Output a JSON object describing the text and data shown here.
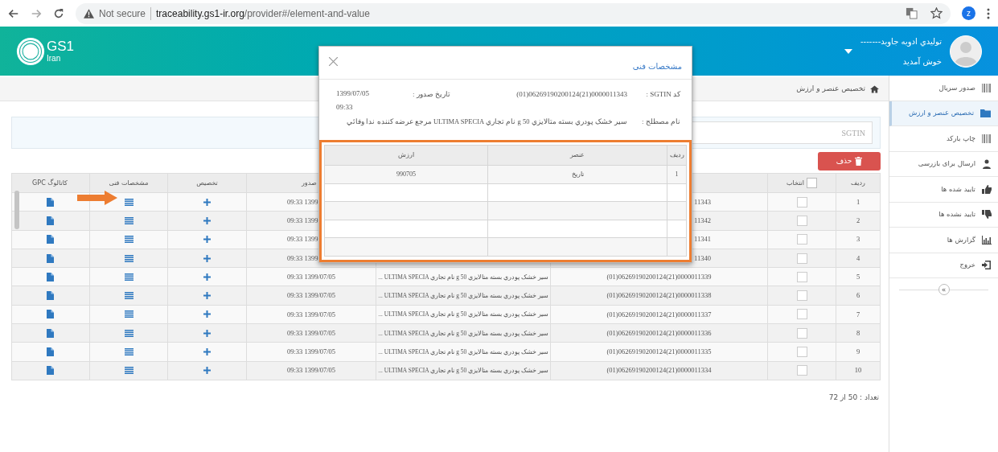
{
  "browser": {
    "security": "Not secure",
    "url_host": "traceability.gs1-ir.org",
    "url_path": "/provider#/element-and-value",
    "profile_initial": "z"
  },
  "header": {
    "logo_text": "GS1",
    "logo_sub": "Iran",
    "user_name": "-------تولیدي ادویه جاوید",
    "welcome": "خوش آمدید"
  },
  "sidebar": {
    "items": [
      {
        "label": "صدور سریال",
        "kind": "barcode",
        "selected": false
      },
      {
        "label": "تخصیص عنصر و ارزش",
        "kind": "folder",
        "selected": true
      },
      {
        "label": "چاپ بارکد",
        "kind": "barcode",
        "selected": false
      },
      {
        "label": "ارسال برای بازرسی",
        "kind": "users",
        "selected": false
      },
      {
        "label": "تایید شده ها",
        "kind": "thumbs-up",
        "selected": false
      },
      {
        "label": "تایید نشده ها",
        "kind": "thumbs-down",
        "selected": false
      },
      {
        "label": "گزارش ها",
        "kind": "chart",
        "selected": false
      },
      {
        "label": "خروج",
        "kind": "exit",
        "selected": false
      }
    ],
    "collapse": "»"
  },
  "breadcrumb": "تخصیص عنصر و ارزش",
  "search": {
    "placeholder": "SGTIN"
  },
  "delete_button": "حذف",
  "table": {
    "columns": {
      "row": "ردیف",
      "select": "انتخاب",
      "issue_date": "صدور",
      "assign": "تخصیص",
      "tech_specs": "مشخصات فنی",
      "gpc_catalog": "کاتالوگ GPC"
    },
    "select_all_checked": false,
    "rows": [
      {
        "row": "1",
        "checked": false,
        "sgtin": "11343",
        "date": "09:33 1399"
      },
      {
        "row": "2",
        "checked": false,
        "sgtin": "11342",
        "date": "09:33 1399"
      },
      {
        "row": "3",
        "checked": false,
        "sgtin": "11341",
        "date": "09:33 1399"
      },
      {
        "row": "4",
        "checked": false,
        "sgtin": "11340",
        "date": "09:33 1399"
      },
      {
        "row": "5",
        "checked": false,
        "sgtin": "(01)06269190200124(21)0000011339",
        "name": "سیر خشک پودري بسته متالایزي 50 g نام تجاري ULTIMA SPECIA ...",
        "date": "09:33 1399/07/05"
      },
      {
        "row": "6",
        "checked": false,
        "sgtin": "(01)06269190200124(21)0000011338",
        "name": "سیر خشک پودري بسته متالایزي 50 g نام تجاري ULTIMA SPECIA ...",
        "date": "09:33 1399/07/05"
      },
      {
        "row": "7",
        "checked": false,
        "sgtin": "(01)06269190200124(21)0000011337",
        "name": "سیر خشک پودري بسته متالایزي 50 g نام تجاري ULTIMA SPECIA ...",
        "date": "09:33 1399/07/05"
      },
      {
        "row": "8",
        "checked": false,
        "sgtin": "(01)06269190200124(21)0000011336",
        "name": "سیر خشک پودري بسته متالایزي 50 g نام تجاري ULTIMA SPECIA ...",
        "date": "09:33 1399/07/05"
      },
      {
        "row": "9",
        "checked": false,
        "sgtin": "(01)06269190200124(21)0000011335",
        "name": "سیر خشک پودري بسته متالایزي 50 g نام تجاري ULTIMA SPECIA ...",
        "date": "09:33 1399/07/05"
      },
      {
        "row": "10",
        "checked": false,
        "sgtin": "(01)06269190200124(21)0000011334",
        "name": "سیر خشک پودري بسته متالایزي 50 g نام تجاري ULTIMA SPECIA ...",
        "date": "09:33 1399/07/05"
      }
    ]
  },
  "count": "تعداد : 50 از 72",
  "modal": {
    "title": "مشخصات فنی",
    "sgtin_label": "کد SGTIN :",
    "sgtin": "(01)06269190200124(21)0000011343",
    "date_label": "تاریخ صدور :",
    "date": "1399/07/05 09:33",
    "name_label": "نام مصطلح :",
    "name": "سیر خشک پودري بسته متالایزي 50 g نام تجاري ULTIMA SPECIA مرجع عرضه کننده ندا وفائي",
    "table": {
      "columns": [
        "ردیف",
        "عنصر",
        "ارزش"
      ],
      "rows": [
        [
          "1",
          "تاریخ",
          "990705"
        ]
      ]
    }
  }
}
